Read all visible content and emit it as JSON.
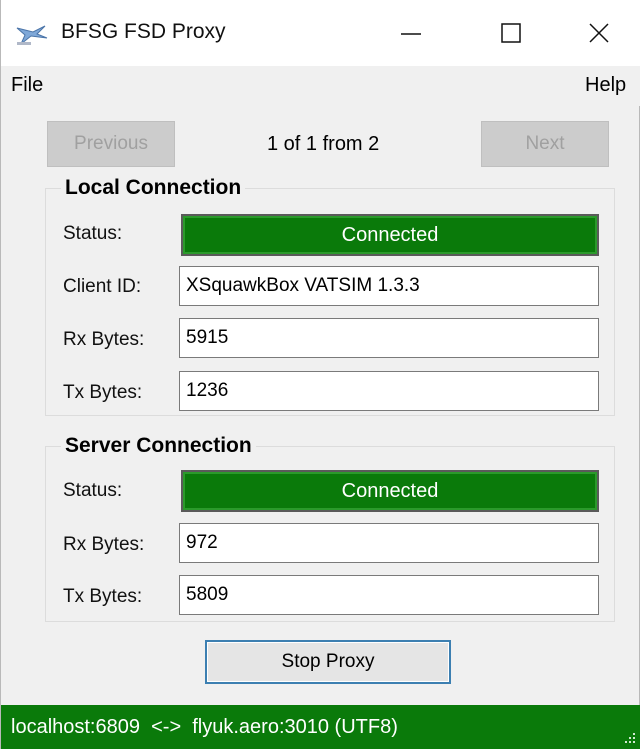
{
  "window": {
    "title": "BFSG FSD Proxy",
    "icon": "app-icon",
    "controls": [
      "minimize-icon",
      "maximize-icon",
      "close-icon"
    ]
  },
  "menu": {
    "file": "File",
    "help": "Help"
  },
  "pager": {
    "previous": "Previous",
    "info": "1 of 1 from 2",
    "next": "Next"
  },
  "local": {
    "title": "Local Connection",
    "status_label": "Status:",
    "status_value": "Connected",
    "client_label": "Client ID:",
    "client_value": "XSquawkBox VATSIM 1.3.3",
    "rx_label": "Rx Bytes:",
    "rx_value": "5915",
    "tx_label": "Tx Bytes:",
    "tx_value": "1236"
  },
  "server": {
    "title": "Server Connection",
    "status_label": "Status:",
    "status_value": "Connected",
    "rx_label": "Rx Bytes:",
    "rx_value": "972",
    "tx_label": "Tx Bytes:",
    "tx_value": "5809"
  },
  "actions": {
    "stop": "Stop Proxy"
  },
  "statusbar": {
    "text": "localhost:6809  <->  flyuk.aero:3010 (UTF8)"
  },
  "colors": {
    "connected": "#0a7a0a",
    "statusbar": "#0a7a0a"
  }
}
